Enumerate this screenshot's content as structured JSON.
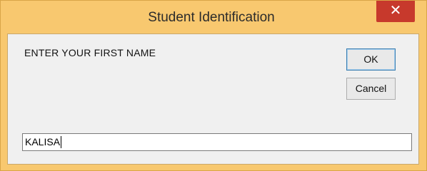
{
  "window": {
    "title": "Student Identification",
    "close_glyph": "✕",
    "close_icon": "close-icon",
    "titlebar_color": "#f8c86f",
    "close_button_color": "#c7392c"
  },
  "prompt": {
    "text": "ENTER YOUR FIRST NAME"
  },
  "buttons": {
    "ok_label": "OK",
    "cancel_label": "Cancel"
  },
  "input": {
    "value": "KALISA"
  }
}
